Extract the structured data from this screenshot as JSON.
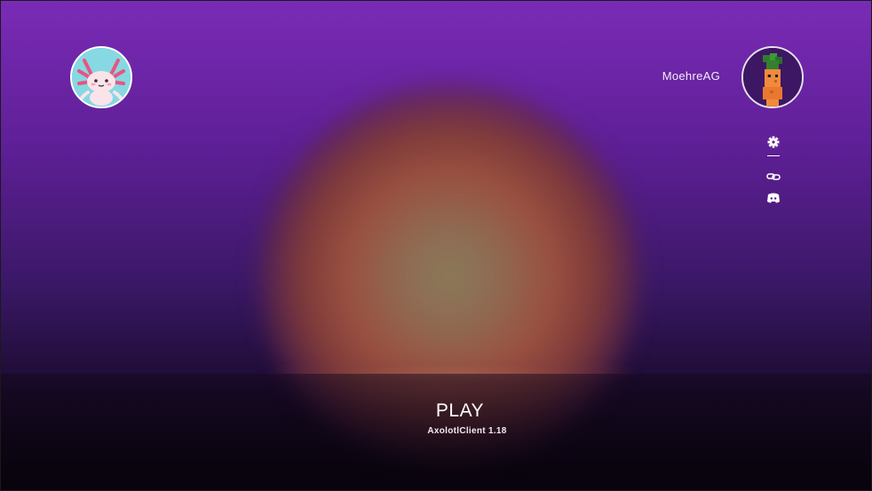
{
  "app": {
    "client_version_label": "AxolotlClient 1.18"
  },
  "header": {
    "logo_icon": "axolotl-logo-icon",
    "username": "MoehreAG",
    "player_avatar_icon": "player-skin-avatar-icon"
  },
  "side_menu": {
    "items": [
      {
        "icon": "gear-icon",
        "action": "settings"
      },
      {
        "icon": "divider"
      },
      {
        "icon": "link-icon",
        "action": "links"
      },
      {
        "icon": "discord-icon",
        "action": "discord"
      }
    ]
  },
  "main": {
    "play_label": "PLAY"
  },
  "colors": {
    "background_top": "#7a2bb6",
    "background_bottom": "#0c0412",
    "glow": "#9a5040",
    "text": "#ffffff"
  }
}
